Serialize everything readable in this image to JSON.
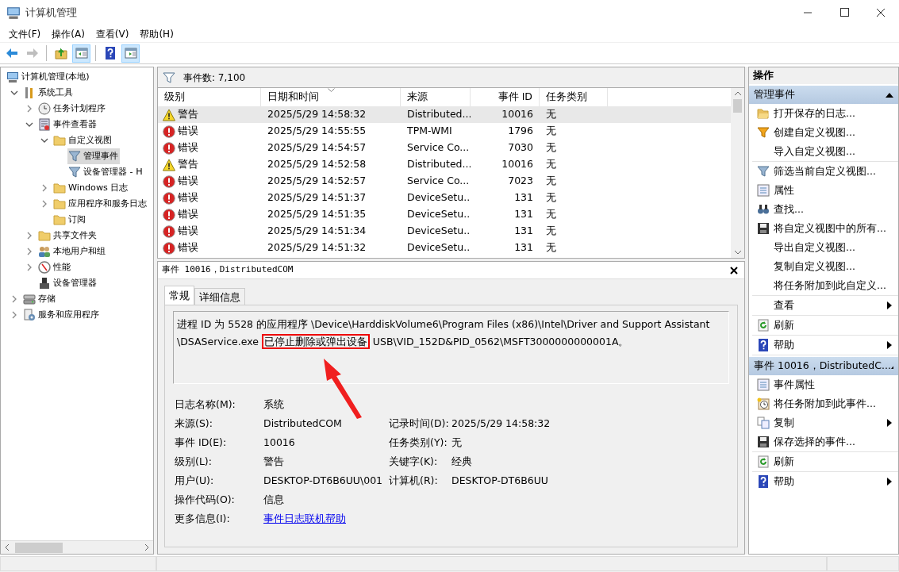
{
  "window": {
    "title": "计算机管理"
  },
  "menu": [
    "文件(F)",
    "操作(A)",
    "查看(V)",
    "帮助(H)"
  ],
  "toolbar": [
    {
      "kind": "back",
      "pressed": false,
      "disabled": false
    },
    {
      "kind": "forward",
      "pressed": false,
      "disabled": true
    },
    {
      "kind": "up",
      "pressed": false,
      "disabled": false
    },
    {
      "kind": "tree",
      "pressed": true,
      "disabled": false
    },
    {
      "kind": "help",
      "pressed": false,
      "disabled": false
    },
    {
      "kind": "action",
      "pressed": true,
      "disabled": false
    }
  ],
  "tree": [
    {
      "label": "计算机管理(本地)",
      "kind": "computer",
      "selected": false,
      "children": [
        {
          "label": "系统工具",
          "kind": "tools",
          "expanded": true,
          "selected": false,
          "children": [
            {
              "label": "任务计划程序",
              "kind": "clock",
              "expanded": false,
              "selected": false
            },
            {
              "label": "事件查看器",
              "kind": "logbook",
              "expanded": true,
              "selected": false,
              "children": [
                {
                  "label": "自定义视图",
                  "kind": "folder",
                  "expanded": true,
                  "selected": false,
                  "children": [
                    {
                      "label": "管理事件",
                      "kind": "filter",
                      "selected": true
                    },
                    {
                      "label": "设备管理器 - H",
                      "kind": "filter",
                      "selected": false
                    }
                  ]
                },
                {
                  "label": "Windows 日志",
                  "kind": "folder",
                  "expanded": false,
                  "selected": false
                },
                {
                  "label": "应用程序和服务日志",
                  "kind": "folder",
                  "expanded": false,
                  "selected": false
                },
                {
                  "label": "订阅",
                  "kind": "folder",
                  "selected": false
                }
              ]
            },
            {
              "label": "共享文件夹",
              "kind": "folder",
              "expanded": false,
              "selected": false
            },
            {
              "label": "本地用户和组",
              "kind": "users",
              "expanded": false,
              "selected": false
            },
            {
              "label": "性能",
              "kind": "gauge",
              "expanded": false,
              "selected": false
            },
            {
              "label": "设备管理器",
              "kind": "device",
              "selected": false
            }
          ]
        },
        {
          "label": "存储",
          "kind": "drive",
          "expanded": false,
          "selected": false
        },
        {
          "label": "服务和应用程序",
          "kind": "services",
          "expanded": false,
          "selected": false
        }
      ]
    }
  ],
  "events": {
    "count_label": "事件数: 7,100",
    "columns": [
      {
        "label": "级别",
        "sorted": false
      },
      {
        "label": "日期和时间",
        "sorted": true
      },
      {
        "label": "来源",
        "sorted": false
      },
      {
        "label": "事件 ID",
        "sorted": false
      },
      {
        "label": "任务类别",
        "sorted": false
      }
    ],
    "rows": [
      {
        "kind": "warning",
        "level": "警告",
        "date": "2025/5/29 14:58:32",
        "source": "Distributed...",
        "id": "10016",
        "task": "无",
        "selected": true
      },
      {
        "kind": "error",
        "level": "错误",
        "date": "2025/5/29 14:55:55",
        "source": "TPM-WMI",
        "id": "1796",
        "task": "无",
        "selected": false
      },
      {
        "kind": "error",
        "level": "错误",
        "date": "2025/5/29 14:54:57",
        "source": "Service Co...",
        "id": "7030",
        "task": "无",
        "selected": false
      },
      {
        "kind": "warning",
        "level": "警告",
        "date": "2025/5/29 14:52:58",
        "source": "Distributed...",
        "id": "10016",
        "task": "无",
        "selected": false
      },
      {
        "kind": "error",
        "level": "错误",
        "date": "2025/5/29 14:52:57",
        "source": "Service Co...",
        "id": "7023",
        "task": "无",
        "selected": false
      },
      {
        "kind": "error",
        "level": "错误",
        "date": "2025/5/29 14:51:37",
        "source": "DeviceSetu...",
        "id": "131",
        "task": "无",
        "selected": false
      },
      {
        "kind": "error",
        "level": "错误",
        "date": "2025/5/29 14:51:35",
        "source": "DeviceSetu...",
        "id": "131",
        "task": "无",
        "selected": false
      },
      {
        "kind": "error",
        "level": "错误",
        "date": "2025/5/29 14:51:34",
        "source": "DeviceSetu...",
        "id": "131",
        "task": "无",
        "selected": false
      },
      {
        "kind": "error",
        "level": "错误",
        "date": "2025/5/29 14:51:32",
        "source": "DeviceSetu...",
        "id": "131",
        "task": "无",
        "selected": false
      }
    ]
  },
  "detail": {
    "title": "事件 10016，DistributedCOM",
    "tabs": [
      {
        "label": "常规",
        "selected": true
      },
      {
        "label": "详细信息",
        "selected": false
      }
    ],
    "description": [
      {
        "text": "进程 ID 为 5528 的应用程序 \\Device\\HarddiskVolume6\\Program Files (x86)\\Intel\\Driver and Support Assistant \\DSAService.exe ",
        "highlighted": false
      },
      {
        "text": "已停止删除或弹出设备",
        "highlighted": true
      },
      {
        "text": " USB\\VID_152D&PID_0562\\MSFT3000000000001A。",
        "highlighted": false
      }
    ],
    "properties": [
      [
        {
          "label": "日志名称(M):",
          "value": "系统"
        }
      ],
      [
        {
          "label": "来源(S):",
          "value": "DistributedCOM"
        },
        {
          "label": "记录时间(D):",
          "value": "2025/5/29 14:58:32"
        }
      ],
      [
        {
          "label": "事件 ID(E):",
          "value": "10016"
        },
        {
          "label": "任务类别(Y):",
          "value": "无"
        }
      ],
      [
        {
          "label": "级别(L):",
          "value": "警告"
        },
        {
          "label": "关键字(K):",
          "value": "经典"
        }
      ],
      [
        {
          "label": "用户(U):",
          "value": "DESKTOP-DT6B6UU\\001"
        },
        {
          "label": "计算机(R):",
          "value": "DESKTOP-DT6B6UU"
        }
      ],
      [
        {
          "label": "操作代码(O):",
          "value": "信息"
        }
      ],
      [
        {
          "label": "更多信息(I):",
          "value": "事件日志联机帮助",
          "kind": "link"
        }
      ]
    ]
  },
  "actions": {
    "title": "操作",
    "sections": [
      {
        "title": "管理事件",
        "expanded": true,
        "groups": [
          [
            {
              "label": "打开保存的日志...",
              "kind": "open"
            },
            {
              "label": "创建自定义视图...",
              "kind": "filter-new"
            },
            {
              "label": "导入自定义视图..."
            }
          ],
          [
            {
              "label": "筛选当前自定义视图...",
              "kind": "filter"
            },
            {
              "label": "属性",
              "kind": "props"
            },
            {
              "label": "查找...",
              "kind": "find"
            },
            {
              "label": "将自定义视图中的所有...",
              "kind": "save"
            },
            {
              "label": "导出自定义视图..."
            },
            {
              "label": "复制自定义视图..."
            },
            {
              "label": "将任务附加到此自定义..."
            }
          ],
          [
            {
              "label": "查看",
              "submenu": true
            }
          ],
          [
            {
              "label": "刷新",
              "kind": "refresh"
            }
          ],
          [
            {
              "label": "帮助",
              "kind": "help",
              "submenu": true
            }
          ]
        ]
      },
      {
        "title": "事件 10016，DistributedC...",
        "expanded": true,
        "groups": [
          [
            {
              "label": "事件属性",
              "kind": "props"
            },
            {
              "label": "将任务附加到此事件...",
              "kind": "attach"
            },
            {
              "label": "复制",
              "kind": "copy",
              "submenu": true
            },
            {
              "label": "保存选择的事件...",
              "kind": "save"
            }
          ],
          [
            {
              "label": "刷新",
              "kind": "refresh"
            }
          ],
          [
            {
              "label": "帮助",
              "kind": "help",
              "submenu": true
            }
          ]
        ]
      }
    ]
  }
}
